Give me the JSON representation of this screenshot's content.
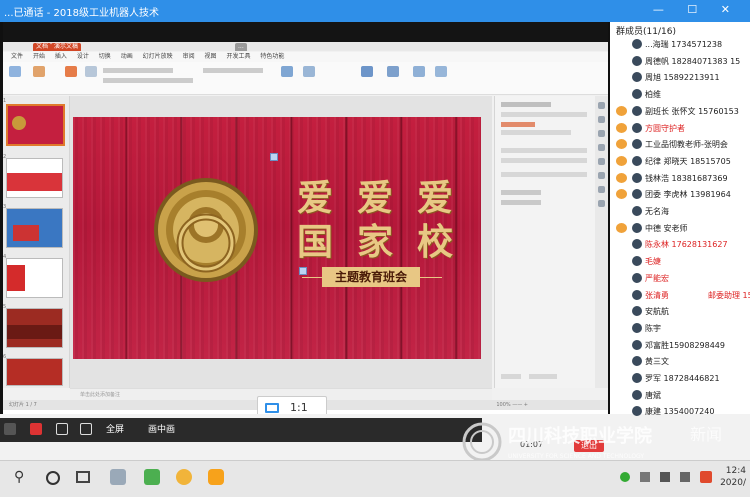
{
  "window": {
    "title": "...已通话 - 2018级工业机器人技术",
    "controls": "— ☐ ✕"
  },
  "app": {
    "tabs": [
      "文档",
      "演示文稿",
      "..."
    ],
    "menu": [
      "文件",
      "开始",
      "插入",
      "设计",
      "切换",
      "动画",
      "幻灯片放映",
      "审阅",
      "视图",
      "开发工具",
      "特色功能"
    ],
    "thumb_numbers": [
      "1",
      "2",
      "3",
      "4",
      "5",
      "6"
    ],
    "notes_placeholder": "单击此处添加备注",
    "status_left": "幻灯片 1 / 7",
    "status_right": "100% —— +"
  },
  "slide": {
    "title_line1": "爱爱爱",
    "title_line2": "国家校",
    "subtitle": "主题教育班会"
  },
  "zoom": {
    "value": "1:1"
  },
  "meeting_bar": {
    "items": [
      "全屏",
      "画中画"
    ],
    "timer": "01:07",
    "end_label": "退出"
  },
  "members": {
    "header": "群成员(11/16)",
    "list": [
      {
        "name": "...海瑞 1734571238",
        "color": "blk",
        "tag": ""
      },
      {
        "name": "周德帆 18284071383 15",
        "color": "blk",
        "tag": ""
      },
      {
        "name": "周旭 15892213911",
        "color": "blk",
        "tag": ""
      },
      {
        "name": "柏维",
        "color": "blk",
        "tag": ""
      },
      {
        "name": "副班长 张怀文 15760153",
        "color": "blk",
        "tag": ""
      },
      {
        "name": "方圆守护者",
        "color": "red",
        "tag": ""
      },
      {
        "name": "工业品彻教老师-张明会",
        "color": "blk",
        "tag": ""
      },
      {
        "name": "纪律 郑晓天 18515705",
        "color": "blk",
        "tag": ""
      },
      {
        "name": "钱林浩 18381687369",
        "color": "blk",
        "tag": ""
      },
      {
        "name": "团委 李虎林 13981964",
        "color": "blk",
        "tag": ""
      },
      {
        "name": "无名海",
        "color": "blk",
        "tag": ""
      },
      {
        "name": "中德 安老师",
        "color": "blk",
        "tag": ""
      },
      {
        "name": "陈永林 17628131627",
        "color": "red",
        "tag": ""
      },
      {
        "name": "毛婕",
        "color": "red",
        "tag": ""
      },
      {
        "name": "严能宏",
        "color": "red",
        "tag": ""
      },
      {
        "name": "张清勇",
        "color": "red",
        "tag": "邮委助理 151"
      },
      {
        "name": "安航航",
        "color": "blk",
        "tag": ""
      },
      {
        "name": "陈宇",
        "color": "blk",
        "tag": ""
      },
      {
        "name": "邓富胜15908298449",
        "color": "blk",
        "tag": ""
      },
      {
        "name": "黄三文",
        "color": "blk",
        "tag": ""
      },
      {
        "name": "罗军 18728446821",
        "color": "blk",
        "tag": ""
      },
      {
        "name": "唐斌",
        "color": "blk",
        "tag": ""
      },
      {
        "name": "康建 1354007240",
        "color": "blk",
        "tag": ""
      }
    ]
  },
  "watermark": {
    "text": "四川科技职业学院",
    "text2": "新闻",
    "sub": "UNIVERSITY FOR SCIENCE AND TECHNOLOGY"
  },
  "taskbar": {
    "time": "12:4",
    "date": "2020/"
  },
  "colors": {
    "accent": "#2f8fe8",
    "slide_red": "#c41f3f",
    "gold": "#e8c784"
  }
}
